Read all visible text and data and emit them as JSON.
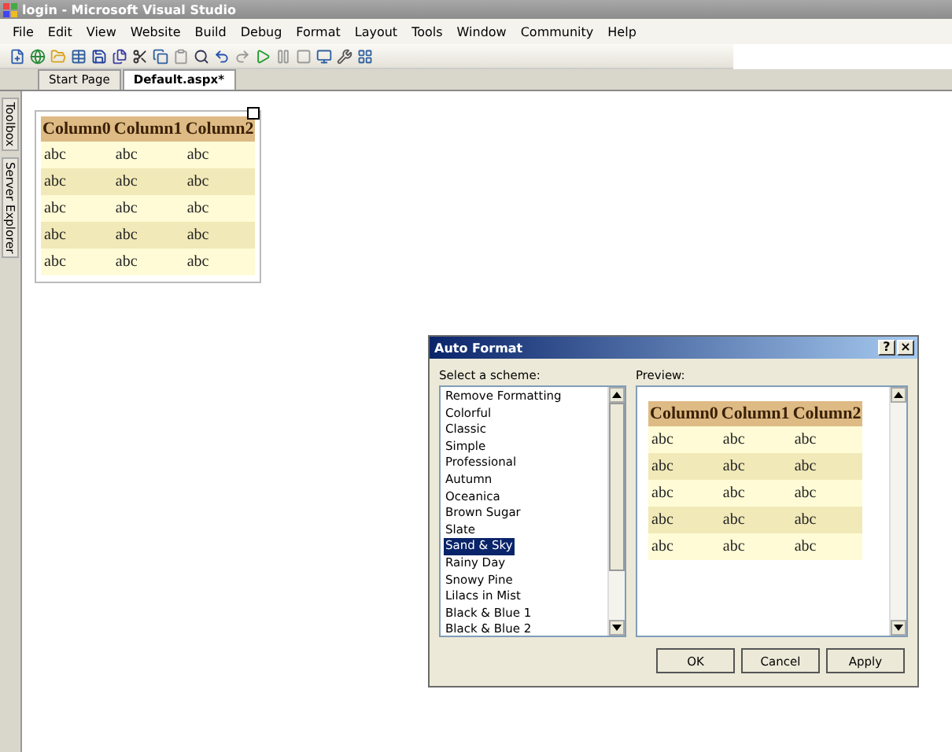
{
  "window": {
    "title": "login - Microsoft Visual Studio"
  },
  "menu": [
    "File",
    "Edit",
    "View",
    "Website",
    "Build",
    "Debug",
    "Format",
    "Layout",
    "Tools",
    "Window",
    "Community",
    "Help"
  ],
  "tabs": [
    {
      "label": "Start Page",
      "selected": false
    },
    {
      "label": "Default.aspx*",
      "selected": true
    }
  ],
  "side_panels": [
    "Toolbox",
    "Server Explorer"
  ],
  "designer_grid": {
    "columns": [
      "Column0",
      "Column1",
      "Column2"
    ],
    "rows": [
      [
        "abc",
        "abc",
        "abc"
      ],
      [
        "abc",
        "abc",
        "abc"
      ],
      [
        "abc",
        "abc",
        "abc"
      ],
      [
        "abc",
        "abc",
        "abc"
      ],
      [
        "abc",
        "abc",
        "abc"
      ]
    ]
  },
  "dialog": {
    "title": "Auto Format",
    "help": "?",
    "close": "×",
    "scheme_label": "Select a scheme:",
    "schemes": [
      {
        "label": "Remove Formatting",
        "selected": false
      },
      {
        "label": "Colorful",
        "selected": false
      },
      {
        "label": "Classic",
        "selected": false
      },
      {
        "label": "Simple",
        "selected": false
      },
      {
        "label": "Professional",
        "selected": false
      },
      {
        "label": "Autumn",
        "selected": false
      },
      {
        "label": "Oceanica",
        "selected": false
      },
      {
        "label": "Brown Sugar",
        "selected": false
      },
      {
        "label": "Slate",
        "selected": false
      },
      {
        "label": "Sand & Sky",
        "selected": true
      },
      {
        "label": "Rainy Day",
        "selected": false
      },
      {
        "label": "Snowy Pine",
        "selected": false
      },
      {
        "label": "Lilacs in Mist",
        "selected": false
      },
      {
        "label": "Black & Blue 1",
        "selected": false
      },
      {
        "label": "Black & Blue 2",
        "selected": false
      }
    ],
    "preview_label": "Preview:",
    "preview_grid": {
      "columns": [
        "Column0",
        "Column1",
        "Column2"
      ],
      "rows": [
        [
          "abc",
          "abc",
          "abc"
        ],
        [
          "abc",
          "abc",
          "abc"
        ],
        [
          "abc",
          "abc",
          "abc"
        ],
        [
          "abc",
          "abc",
          "abc"
        ],
        [
          "abc",
          "abc",
          "abc"
        ]
      ]
    },
    "buttons": [
      "OK",
      "Cancel",
      "Apply"
    ]
  }
}
